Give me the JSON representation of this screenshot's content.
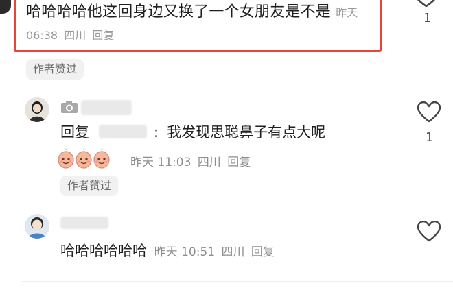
{
  "top_comment": {
    "text": "哈哈哈哈他这回身边又换了一个女朋友是不是",
    "time": "昨天 06:38",
    "location": "四川",
    "reply_label": "回复",
    "like_count": "1",
    "author_liked": "作者赞过"
  },
  "reply_comment": {
    "reply_prefix": "回复",
    "colon": ":",
    "text": "我发现思聪鼻子有点大呢",
    "time": "昨天 11:03",
    "location": "四川",
    "reply_label": "回复",
    "like_count": "1",
    "author_liked": "作者赞过",
    "emoji": [
      "peach-face-emoji",
      "peach-face-emoji",
      "peach-face-emoji"
    ]
  },
  "third_comment": {
    "text": "哈哈哈哈哈哈",
    "time": "昨天 10:51",
    "location": "四川",
    "reply_label": "回复"
  },
  "colors": {
    "highlight_border": "#e8443a",
    "meta_text": "#9a9a9a",
    "chip_bg": "#f1f1f1"
  }
}
